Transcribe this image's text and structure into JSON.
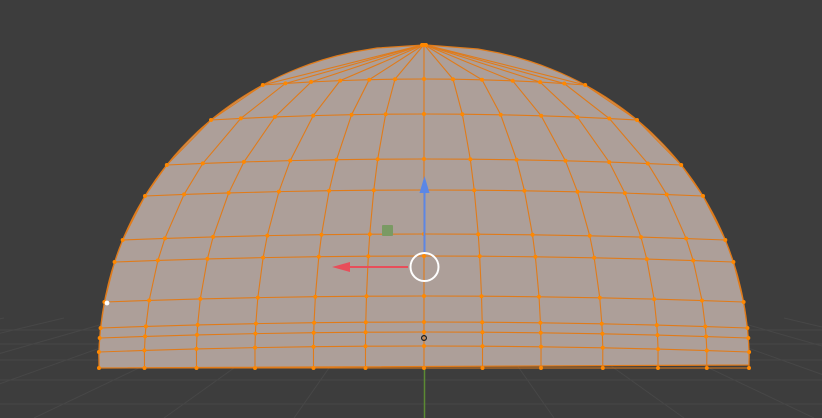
{
  "viewport": {
    "mode": "edit-mode",
    "view": "front-orthographic",
    "background_color": "#3d3d3d",
    "grid_line_color": "#474747",
    "y_axis_color": "#5c8a33",
    "mesh": {
      "name": "hemisphere-dome-mesh",
      "face_color": "#ad9f99",
      "edge_color": "#e07b1a",
      "vertex_color": "#ff8800",
      "active_vertex_color": "#ffffff"
    },
    "gizmo": {
      "x_arrow_color": "#e84e5a",
      "z_arrow_color": "#5b87e6",
      "center_ring_color": "#ffffff",
      "plane_handle_color": "#7a9a63"
    },
    "icons": [
      "move-gizmo-icon",
      "origin-icon"
    ]
  }
}
